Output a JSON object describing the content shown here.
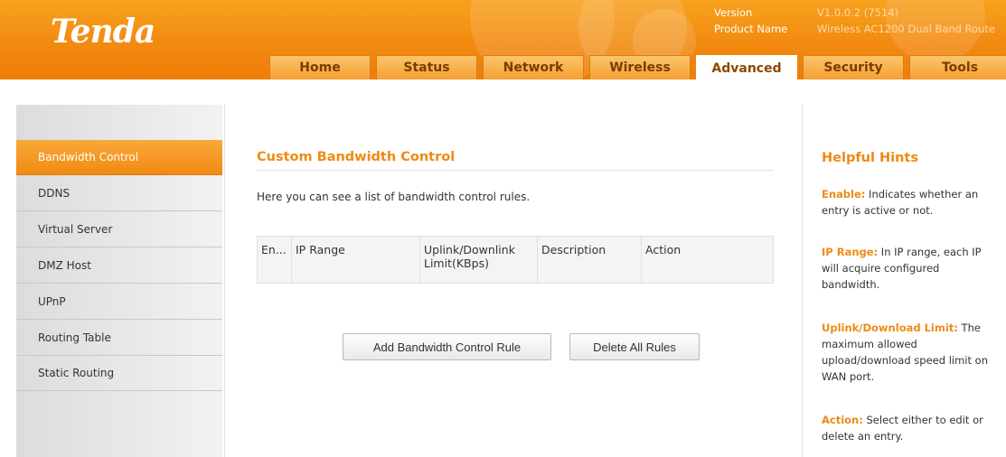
{
  "brand": {
    "logo": "Tenda"
  },
  "device_info": {
    "version_label": "Version",
    "version_value": "V1.0.0.2 (7514)",
    "product_label": "Product Name",
    "product_value": "Wireless AC1200 Dual Band Route"
  },
  "nav": {
    "tabs": [
      {
        "label": "Home"
      },
      {
        "label": "Status"
      },
      {
        "label": "Network"
      },
      {
        "label": "Wireless"
      },
      {
        "label": "Advanced",
        "active": true
      },
      {
        "label": "Security"
      },
      {
        "label": "Tools"
      }
    ]
  },
  "sidebar": {
    "items": [
      {
        "label": "Bandwidth Control",
        "active": true
      },
      {
        "label": "DDNS"
      },
      {
        "label": "Virtual Server"
      },
      {
        "label": "DMZ Host"
      },
      {
        "label": "UPnP"
      },
      {
        "label": "Routing Table"
      },
      {
        "label": "Static Routing"
      }
    ]
  },
  "main": {
    "title": "Custom Bandwidth Control",
    "description": "Here you can see a list of bandwidth control rules.",
    "table_headers": [
      "En...",
      "IP Range",
      "Uplink/Downlink Limit(KBps)",
      "Description",
      "Action"
    ],
    "add_button": "Add Bandwidth Control Rule",
    "delete_button": "Delete All Rules"
  },
  "hints": {
    "title": "Helpful Hints",
    "items": [
      {
        "term": "Enable:",
        "text": " Indicates whether an entry is active or not."
      },
      {
        "term": "IP Range:",
        "text": " In IP range, each IP will acquire configured bandwidth."
      },
      {
        "term": "Uplink/Download Limit:",
        "text": " The maximum allowed upload/download speed limit on WAN port."
      },
      {
        "term": "Action:",
        "text": " Select either to edit or delete an entry."
      }
    ]
  },
  "colors": {
    "accent": "#f28a10",
    "hint_term": "#ee8a16"
  }
}
